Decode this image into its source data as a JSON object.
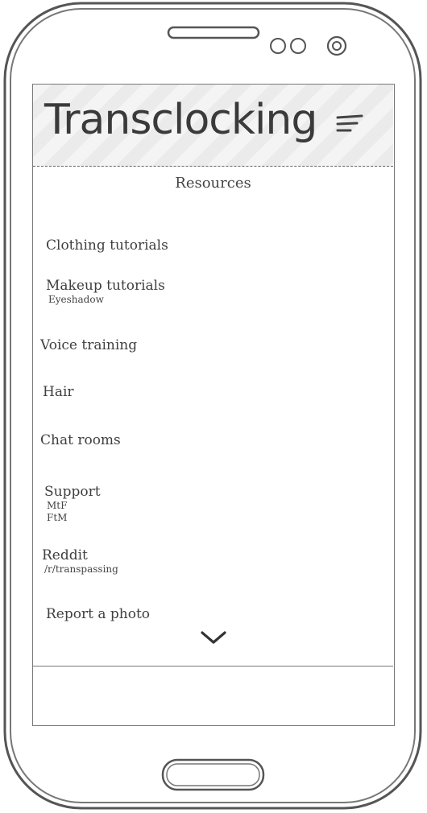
{
  "app": {
    "title": "Transclocking"
  },
  "icons": {
    "menu": "hamburger-menu-icon",
    "more": "chevron-down-icon",
    "camera": "camera-icon",
    "speaker": "speaker-icon"
  },
  "section_title": "Resources",
  "items": [
    {
      "label": "Clothing tutorials"
    },
    {
      "label": "Makeup tutorials",
      "sub": [
        "Eyeshadow"
      ]
    },
    {
      "label": "Voice training"
    },
    {
      "label": "Hair"
    },
    {
      "label": "Chat rooms"
    },
    {
      "label": "Support",
      "sub": [
        "MtF",
        "FtM"
      ]
    },
    {
      "label": "Reddit",
      "sub": [
        "/r/transpassing"
      ]
    },
    {
      "label": "Report a photo"
    }
  ]
}
